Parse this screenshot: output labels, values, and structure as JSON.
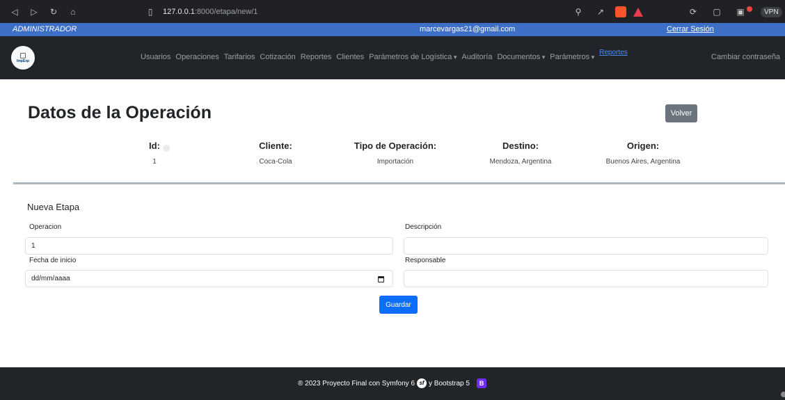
{
  "browser": {
    "url_host": "127.0.0.1",
    "url_rest": ":8000/etapa/new/1",
    "vpn_label": "VPN"
  },
  "topbar": {
    "role": "ADMINISTRADOR",
    "email": "marcevargas21@gmail.com",
    "logout": "Cerrar Sesión"
  },
  "navbar": {
    "logo_text": "ImpExp",
    "items": [
      {
        "label": "Usuarios",
        "dropdown": false
      },
      {
        "label": "Operaciones",
        "dropdown": false
      },
      {
        "label": "Tarifarios",
        "dropdown": false
      },
      {
        "label": "Cotización",
        "dropdown": false
      },
      {
        "label": "Reportes",
        "dropdown": false
      },
      {
        "label": "Clientes",
        "dropdown": false
      },
      {
        "label": "Parámetros de Logística",
        "dropdown": true
      },
      {
        "label": "Auditoría",
        "dropdown": false
      },
      {
        "label": "Documentos",
        "dropdown": true
      },
      {
        "label": "Parámetros",
        "dropdown": true
      }
    ],
    "reportes_link": "Reportes",
    "change_password": "Cambiar contraseña"
  },
  "page": {
    "title": "Datos de la Operación",
    "back_button": "Volver"
  },
  "operation": {
    "fields": [
      {
        "label": "Id:",
        "value": "1"
      },
      {
        "label": "Cliente:",
        "value": "Coca-Cola"
      },
      {
        "label": "Tipo de Operación:",
        "value": "Importación"
      },
      {
        "label": "Destino:",
        "value": "Mendoza, Argentina"
      },
      {
        "label": "Origen:",
        "value": "Buenos Aires, Argentina"
      }
    ]
  },
  "form": {
    "title": "Nueva Etapa",
    "operacion_label": "Operacion",
    "operacion_value": "1",
    "descripcion_label": "Descripción",
    "descripcion_value": "",
    "fecha_label": "Fecha de inicio",
    "fecha_placeholder": "dd/mm/aaaa",
    "responsable_label": "Responsable",
    "responsable_value": "",
    "save_button": "Guardar"
  },
  "footer": {
    "text_before": "® 2023 Proyecto Final con Symfony 6",
    "text_middle": "y Bootstrap 5",
    "symfony_glyph": "sf",
    "bootstrap_glyph": "B"
  }
}
